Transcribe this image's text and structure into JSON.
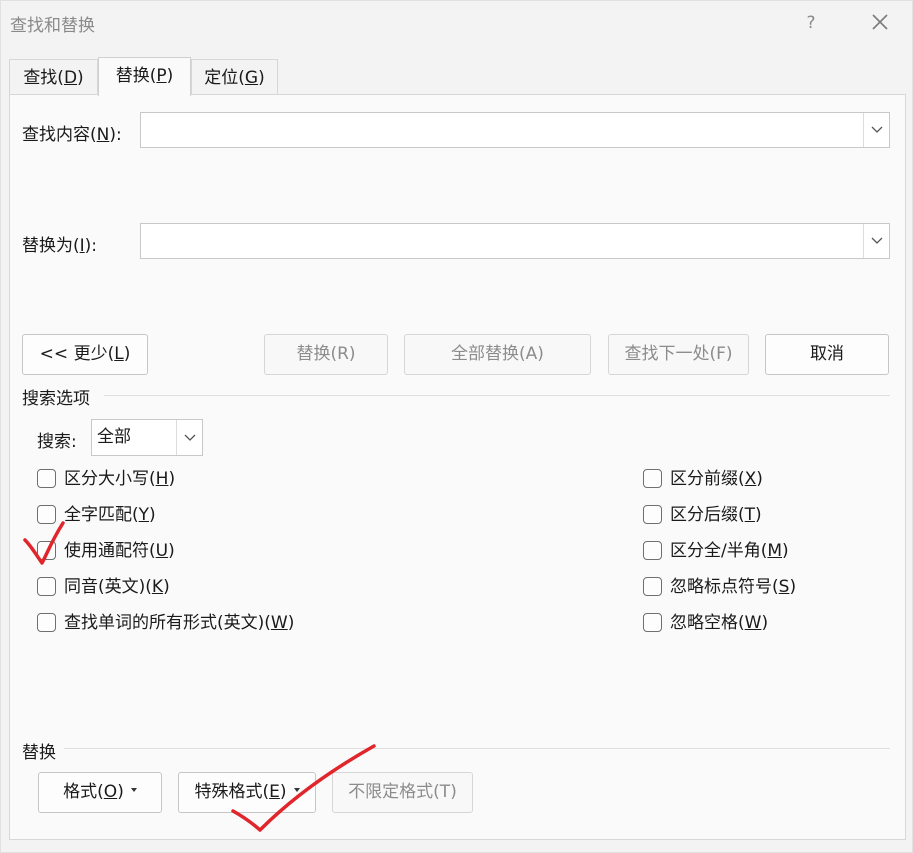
{
  "window": {
    "title": "查找和替换",
    "help": "?"
  },
  "tabs": [
    {
      "label": "查找(D)",
      "prefix": "查找(",
      "mnemonic": "D",
      "suffix": ")",
      "active": false
    },
    {
      "label": "替换(P)",
      "prefix": "替换(",
      "mnemonic": "P",
      "suffix": ")",
      "active": true
    },
    {
      "label": "定位(G)",
      "prefix": "定位(",
      "mnemonic": "G",
      "suffix": ")",
      "active": false
    }
  ],
  "find": {
    "prefix": "查找内容(",
    "mnemonic": "N",
    "suffix": "):",
    "value": ""
  },
  "replace_with": {
    "prefix": "替换为(",
    "mnemonic": "I",
    "suffix": "):",
    "value": ""
  },
  "buttons": {
    "less": {
      "prefix": "<< 更少(",
      "mnemonic": "L",
      "suffix": ")"
    },
    "replace": "替换(R)",
    "replace_all": "全部替换(A)",
    "find_next": "查找下一处(F)",
    "cancel": "取消"
  },
  "search_options": {
    "title": "搜索选项",
    "search_label": "搜索:",
    "search_value": "全部",
    "left": [
      {
        "prefix": "区分大小写(",
        "mnemonic": "H",
        "suffix": ")",
        "checked": false
      },
      {
        "prefix": "全字匹配(",
        "mnemonic": "Y",
        "suffix": ")",
        "checked": false
      },
      {
        "prefix": "使用通配符(",
        "mnemonic": "U",
        "suffix": ")",
        "checked": false
      },
      {
        "prefix": "同音(英文)(",
        "mnemonic": "K",
        "suffix": ")",
        "checked": false
      },
      {
        "prefix": "查找单词的所有形式(英文)(",
        "mnemonic": "W",
        "suffix": ")",
        "checked": false
      }
    ],
    "right": [
      {
        "prefix": "区分前缀(",
        "mnemonic": "X",
        "suffix": ")",
        "checked": false
      },
      {
        "prefix": "区分后缀(",
        "mnemonic": "T",
        "suffix": ")",
        "checked": false
      },
      {
        "prefix": "区分全/半角(",
        "mnemonic": "M",
        "suffix": ")",
        "checked": false
      },
      {
        "prefix": "忽略标点符号(",
        "mnemonic": "S",
        "suffix": ")",
        "checked": false
      },
      {
        "prefix": "忽略空格(",
        "mnemonic": "W",
        "suffix": ")",
        "checked": false
      }
    ]
  },
  "replace_section": {
    "title": "替换",
    "format": {
      "prefix": "格式(",
      "mnemonic": "O",
      "suffix": ")"
    },
    "special": {
      "prefix": "特殊格式(",
      "mnemonic": "E",
      "suffix": ")"
    },
    "no_formatting": "不限定格式(T)"
  },
  "colors": {
    "annotation": "#e0262b",
    "accent_text": "#1a1a1a",
    "disabled_text": "#8c8c8c"
  }
}
